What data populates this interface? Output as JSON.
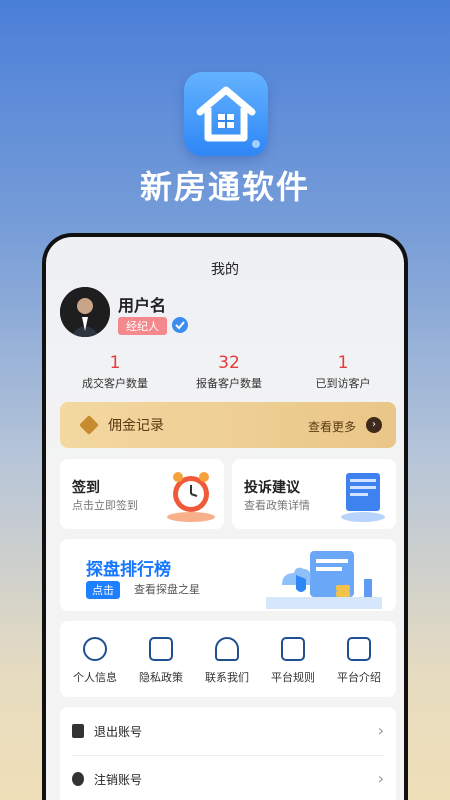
{
  "app": {
    "name": "新房通软件"
  },
  "screen": {
    "title": "我的",
    "user": {
      "name": "用户名",
      "role": "经纪人"
    },
    "stats": [
      {
        "value": "1",
        "label": "成交客户数量"
      },
      {
        "value": "32",
        "label": "报备客户数量"
      },
      {
        "value": "1",
        "label": "已到访客户"
      }
    ],
    "commission": {
      "label": "佣金记录",
      "more": "查看更多"
    },
    "cards": {
      "checkin": {
        "title": "签到",
        "subtitle": "点击立即签到"
      },
      "feedback": {
        "title": "投诉建议",
        "subtitle": "查看政策详情"
      }
    },
    "ranking": {
      "title": "探盘排行榜",
      "tag": "点击",
      "subtitle": "查看探盘之星"
    },
    "menu": [
      {
        "label": "个人信息",
        "icon": "user-icon"
      },
      {
        "label": "隐私政策",
        "icon": "alert-icon"
      },
      {
        "label": "联系我们",
        "icon": "headset-icon"
      },
      {
        "label": "平台规则",
        "icon": "edit-icon"
      },
      {
        "label": "平台介绍",
        "icon": "book-icon"
      }
    ],
    "list": [
      {
        "label": "退出账号",
        "icon": "logout-icon"
      },
      {
        "label": "注销账号",
        "icon": "power-icon"
      }
    ]
  },
  "colors": {
    "accent": "#1677ff",
    "stat": "#e53b3b",
    "badge": "#f4898d",
    "gold": "#eac688"
  }
}
